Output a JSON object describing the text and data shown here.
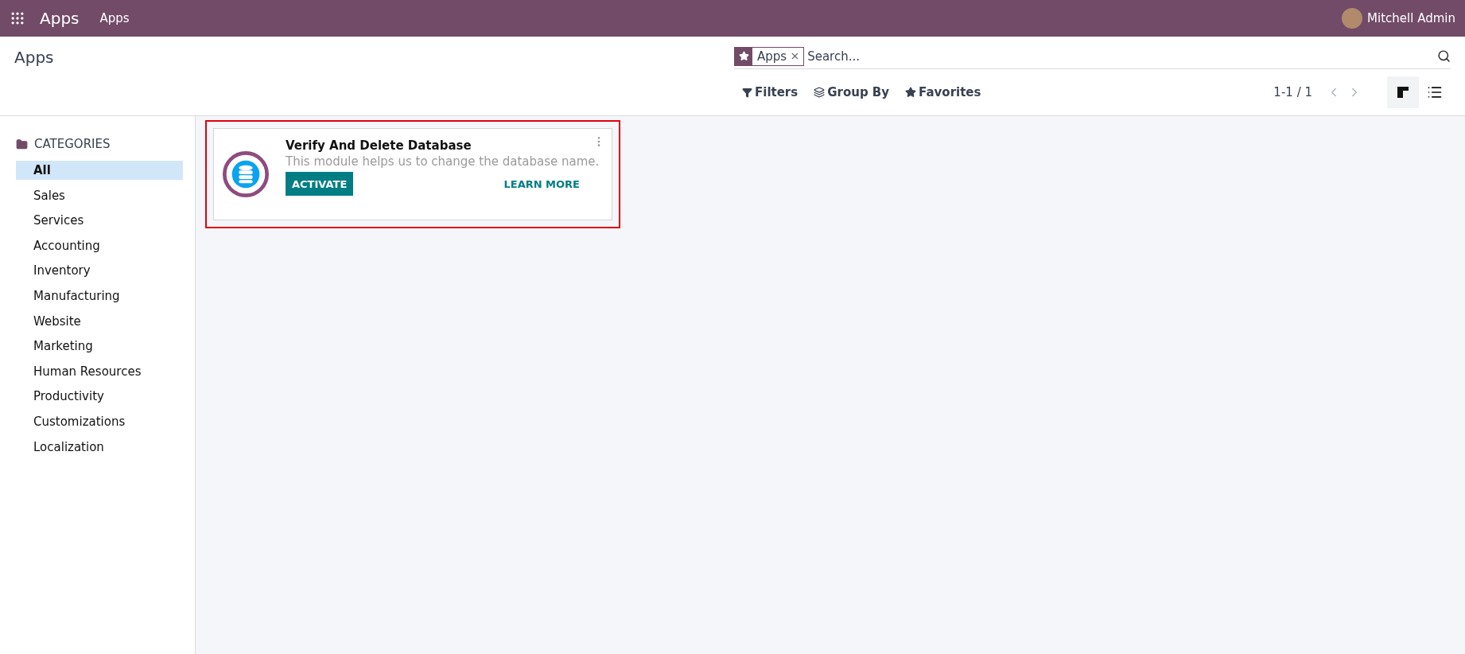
{
  "navbar": {
    "brand": "Apps",
    "menu": [
      "Apps"
    ],
    "user": "Mitchell Admin"
  },
  "control_panel": {
    "title": "Apps",
    "search": {
      "facet": "Apps",
      "placeholder": "Search..."
    },
    "filters": [
      {
        "kind": "filter",
        "label": "Filters"
      },
      {
        "kind": "group",
        "label": "Group By"
      },
      {
        "kind": "favorite",
        "label": "Favorites"
      }
    ],
    "pager": "1-1 / 1",
    "views": [
      {
        "kind": "kanban",
        "selected": true
      },
      {
        "kind": "list",
        "selected": false
      }
    ]
  },
  "sidebar": {
    "heading": "CATEGORIES",
    "items": [
      {
        "label": "All",
        "selected": true
      },
      {
        "label": "Sales",
        "selected": false
      },
      {
        "label": "Services",
        "selected": false
      },
      {
        "label": "Accounting",
        "selected": false
      },
      {
        "label": "Inventory",
        "selected": false
      },
      {
        "label": "Manufacturing",
        "selected": false
      },
      {
        "label": "Website",
        "selected": false
      },
      {
        "label": "Marketing",
        "selected": false
      },
      {
        "label": "Human Resources",
        "selected": false
      },
      {
        "label": "Productivity",
        "selected": false
      },
      {
        "label": "Customizations",
        "selected": false
      },
      {
        "label": "Localization",
        "selected": false
      }
    ]
  },
  "apps": [
    {
      "name": "Verify And Delete Database",
      "summary": "This module helps us to change the database name.",
      "action": "ACTIVATE",
      "link": "LEARN MORE",
      "highlighted": true
    }
  ]
}
